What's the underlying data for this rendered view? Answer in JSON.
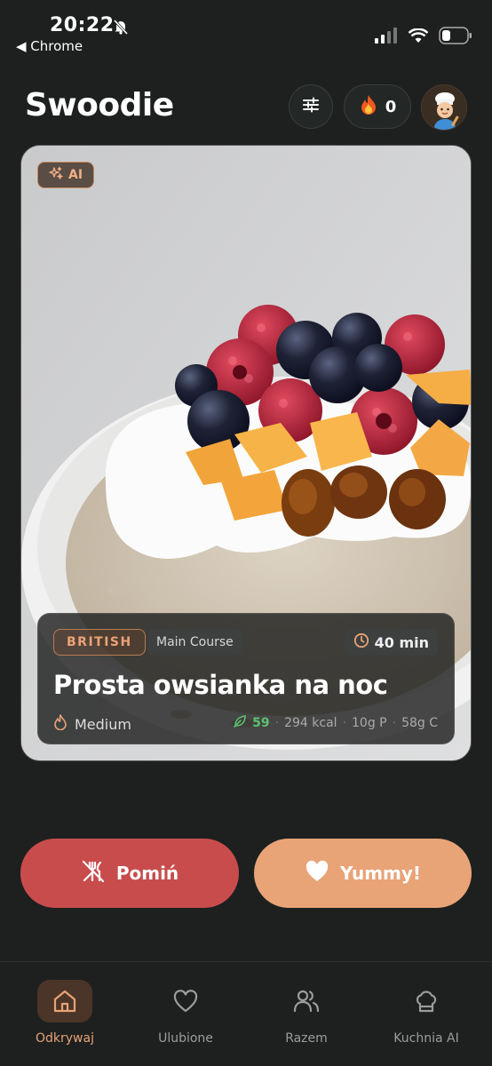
{
  "status_bar": {
    "time": "20:22",
    "back_app": "◀ Chrome"
  },
  "header": {
    "app_title": "Swoodie",
    "streak_icon": "fire-icon",
    "streak_count": "0"
  },
  "card": {
    "ai_badge": "AI",
    "cuisine": "BRITISH",
    "course": "Main Course",
    "time": "40 min",
    "recipe_title": "Prosta owsianka na noc",
    "difficulty": "Medium",
    "health_score": "59",
    "calories": "294 kcal",
    "protein": "10g P",
    "carbs": "58g C",
    "watermark": "swoodie"
  },
  "actions": {
    "skip_label": "Pomiń",
    "yummy_label": "Yummy!"
  },
  "tabs": [
    {
      "label": "Odkrywaj",
      "icon": "home-icon",
      "active": true
    },
    {
      "label": "Ulubione",
      "icon": "heart-icon",
      "active": false
    },
    {
      "label": "Razem",
      "icon": "users-icon",
      "active": false
    },
    {
      "label": "Kuchnia AI",
      "icon": "chef-hat-icon",
      "active": false
    }
  ],
  "colors": {
    "background": "#1d201f",
    "accent": "#e8a377",
    "skip": "#c94c4c",
    "score_green": "#5cc070"
  }
}
